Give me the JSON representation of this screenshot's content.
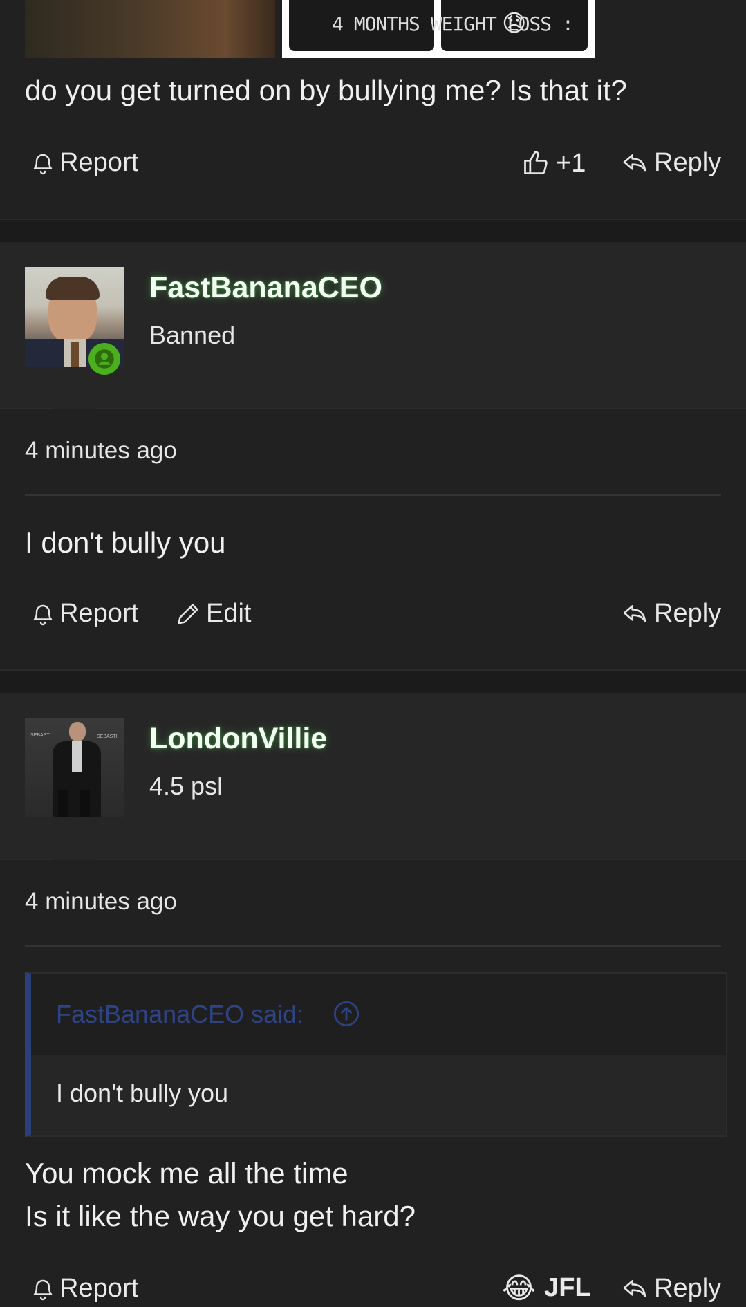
{
  "post1": {
    "image_caption": "4 MONTHS WEIGHT LOSS :",
    "image_emoji": "😞",
    "message": "do you get turned on by bullying me? Is that it?",
    "actions": {
      "report": "Report",
      "like": "+1",
      "reply": "Reply"
    }
  },
  "post2": {
    "username": "FastBananaCEO",
    "user_title": "Banned",
    "time": "4 minutes ago",
    "message": "I don't bully you",
    "actions": {
      "report": "Report",
      "edit": "Edit",
      "reply": "Reply"
    }
  },
  "post3": {
    "username": "LondonVillie",
    "user_title": "4.5 psl",
    "time": "4 minutes ago",
    "quote": {
      "author_line": "FastBananaCEO said:",
      "text": "I don't bully you"
    },
    "message_lines": [
      "You mock me all the time",
      "Is it like the way you get hard?"
    ],
    "actions": {
      "report": "Report",
      "reaction_emoji": "😂",
      "reaction_label": "JFL",
      "reply": "Reply"
    }
  },
  "colors": {
    "background": "#212121",
    "accent_green": "#4caf1e",
    "quote_blue": "#2d3f7a",
    "username_glow": "#5ac85a"
  }
}
